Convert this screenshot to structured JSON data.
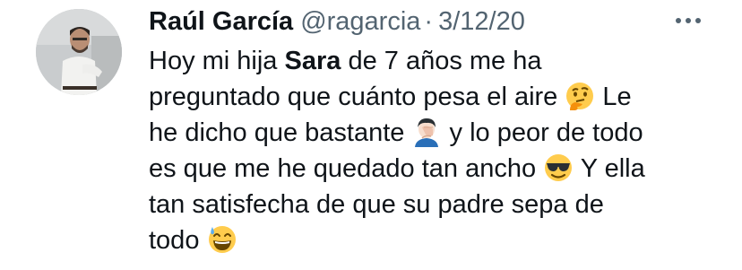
{
  "tweet": {
    "author_name": "Raúl García",
    "handle": "@ragarcia",
    "separator": "·",
    "date": "3/12/20",
    "lines": [
      {
        "a": "Hoy mi hija ",
        "b": "Sara",
        "c": " de 7 años me ha"
      },
      {
        "a": "preguntado que cuánto pesa el aire ",
        "b": "Le"
      },
      {
        "a": "he dicho que bastante ",
        "b": "y lo peor de todo"
      },
      {
        "a": "es que me he quedado tan ancho ",
        "b": "Y ella"
      },
      {
        "a": "tan satisfecha de que su padre sepa de"
      },
      {
        "a": "todo "
      }
    ],
    "emojis": [
      "thinking-face",
      "face-palm",
      "smiling-face-with-sunglasses",
      "grinning-face-with-sweat"
    ]
  },
  "icons": {
    "more": "more-horizontal-icon",
    "avatar": "avatar"
  },
  "colors": {
    "text": "#0f1419",
    "secondary": "#536471",
    "background": "#ffffff"
  }
}
